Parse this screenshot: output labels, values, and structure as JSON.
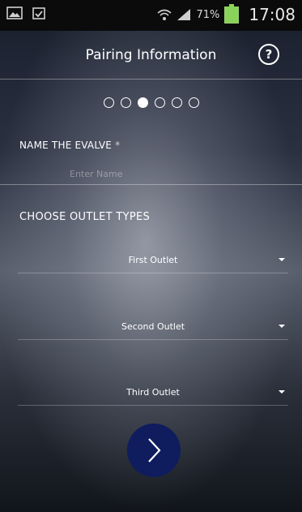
{
  "status_bar": {
    "battery_percent": "71%",
    "time": "17:08",
    "icons": [
      "image-icon",
      "clipboard-check-icon",
      "wifi-icon",
      "signal-icon",
      "battery-icon"
    ]
  },
  "header": {
    "title": "Pairing Information",
    "help_icon": "question-circle-icon",
    "help_glyph": "?"
  },
  "stepper": {
    "total": 6,
    "current": 3
  },
  "name_field": {
    "label": "NAME THE EVALVE",
    "required_marker": "*",
    "placeholder": "Enter Name",
    "value": ""
  },
  "outlets": {
    "title": "CHOOSE OUTLET TYPES",
    "items": [
      {
        "label": "First Outlet"
      },
      {
        "label": "Second Outlet"
      },
      {
        "label": "Third Outlet"
      }
    ]
  },
  "next_button": {
    "icon": "chevron-right-icon"
  }
}
